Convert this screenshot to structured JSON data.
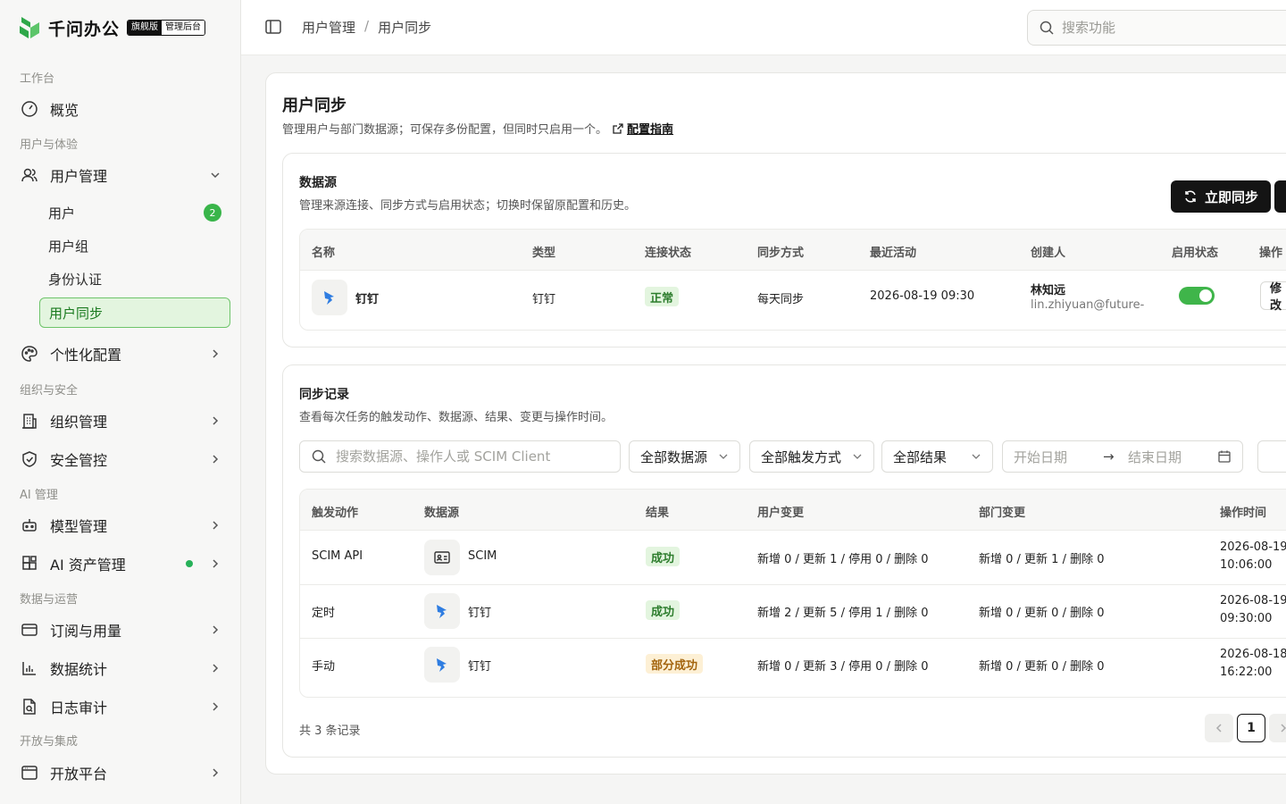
{
  "brand": {
    "name": "千问办公",
    "edition": "旗舰版",
    "console": "管理后台",
    "colors": {
      "primary": "#35b24a",
      "dark": "#141414"
    }
  },
  "sidebar": {
    "groups": {
      "workbench": "工作台",
      "user_exp": "用户与体验",
      "org_security": "组织与安全",
      "ai_manage": "AI 管理",
      "data_ops": "数据与运营",
      "open": "开放与集成"
    },
    "items": {
      "overview": "概览",
      "user_manage": "用户管理",
      "personalize": "个性化配置",
      "org_manage": "组织管理",
      "security": "安全管控",
      "model_manage": "模型管理",
      "ai_assets": "AI 资产管理",
      "subscription": "订阅与用量",
      "statistics": "数据统计",
      "audit": "日志审计",
      "open_platform": "开放平台"
    },
    "sub_items": {
      "users": "用户",
      "users_count": "2",
      "user_groups": "用户组",
      "auth": "身份认证",
      "user_sync": "用户同步"
    }
  },
  "topbar": {
    "breadcrumb": [
      "用户管理",
      "/",
      "用户同步"
    ],
    "search_placeholder": "搜索功能"
  },
  "page": {
    "title": "用户同步",
    "desc": "管理用户与部门数据源；可保存多份配置，但同时只启用一个。",
    "guide": "配置指南"
  },
  "datasource": {
    "title": "数据源",
    "desc": "管理来源连接、同步方式与启用状态；切换时保留原配置和历史。",
    "sync_now": "立即同步",
    "columns": [
      "名称",
      "类型",
      "连接状态",
      "同步方式",
      "最近活动",
      "创建人",
      "启用状态",
      "操作"
    ],
    "row": {
      "name": "钉钉",
      "type": "钉钉",
      "status": "正常",
      "mode": "每天同步",
      "last": "2026-08-19 09:30",
      "creator_name": "林知远",
      "creator_email": "lin.zhiyuan@future-a",
      "enabled": true,
      "action": "修改"
    }
  },
  "records": {
    "title": "同步记录",
    "desc": "查看每次任务的触发动作、数据源、结果、变更与操作时间。",
    "search_placeholder": "搜索数据源、操作人或 SCIM Client",
    "filters": {
      "source": "全部数据源",
      "trigger": "全部触发方式",
      "result": "全部结果"
    },
    "date": {
      "start": "开始日期",
      "arrow": "→",
      "end": "结束日期"
    },
    "columns": [
      "触发动作",
      "数据源",
      "结果",
      "用户变更",
      "部门变更",
      "操作时间"
    ],
    "rows": [
      {
        "trigger": "SCIM API",
        "source": "SCIM",
        "icon": "id-card-icon",
        "result": "成功",
        "kind": "ok",
        "user": "新增 0 / 更新 1 / 停用 0 / 删除 0",
        "dept": "新增 0 / 更新 1 / 删除 0",
        "date": "2026-08-19",
        "time": "10:06:00"
      },
      {
        "trigger": "定时",
        "source": "钉钉",
        "icon": "dingtalk-icon",
        "result": "成功",
        "kind": "ok",
        "user": "新增 2 / 更新 5 / 停用 1 / 删除 0",
        "dept": "新增 0 / 更新 0 / 删除 0",
        "date": "2026-08-19",
        "time": "09:30:00"
      },
      {
        "trigger": "手动",
        "source": "钉钉",
        "icon": "dingtalk-icon",
        "result": "部分成功",
        "kind": "partial",
        "user": "新增 0 / 更新 3 / 停用 0 / 删除 0",
        "dept": "新增 0 / 更新 0 / 删除 0",
        "date": "2026-08-18",
        "time": "16:22:00"
      }
    ],
    "total": "共 3 条记录",
    "page": "1"
  }
}
